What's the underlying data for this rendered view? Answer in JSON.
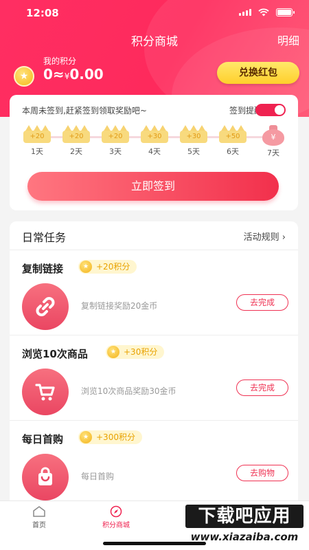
{
  "status_bar": {
    "time": "12:08"
  },
  "header": {
    "title": "积分商城",
    "detail_link": "明细"
  },
  "points": {
    "label": "我的积分",
    "value_prefix": "0≈",
    "currency": "¥",
    "value_amount": "0.00"
  },
  "exchange_button": "兑换红包",
  "signin": {
    "tip": "本周未签到,赶紧签到领取奖励吧~",
    "remind_label": "签到提醒",
    "remind_on": true,
    "days": [
      {
        "reward": "+20",
        "label": "1天"
      },
      {
        "reward": "+20",
        "label": "2天"
      },
      {
        "reward": "+20",
        "label": "3天"
      },
      {
        "reward": "+30",
        "label": "4天"
      },
      {
        "reward": "+30",
        "label": "5天"
      },
      {
        "reward": "+50",
        "label": "6天"
      },
      {
        "reward": "¥",
        "label": "7天"
      }
    ],
    "button": "立即签到"
  },
  "tasks": {
    "title": "日常任务",
    "rules_link": "活动规则",
    "items": [
      {
        "title": "复制链接",
        "reward": "+20积分",
        "desc": "复制链接奖励20金币",
        "action": "去完成",
        "icon": "link-icon"
      },
      {
        "title": "浏览10次商品",
        "reward": "+30积分",
        "desc": "浏览10次商品奖励30金币",
        "action": "去完成",
        "icon": "cart-icon"
      },
      {
        "title": "每日首购",
        "reward": "+300积分",
        "desc": "每日首购",
        "action": "去购物",
        "icon": "shopping-bag-icon"
      }
    ]
  },
  "tabbar": {
    "items": [
      {
        "label": "首页",
        "icon": "home-icon",
        "active": false
      },
      {
        "label": "积分商城",
        "icon": "compass-icon",
        "active": true
      }
    ]
  },
  "watermark": {
    "main": "下载吧应用",
    "sub": "www.xiazaiba.com"
  },
  "colors": {
    "primary": "#ef2250",
    "gold": "#f6b81b",
    "header_gradient_start": "#ff2e62"
  }
}
